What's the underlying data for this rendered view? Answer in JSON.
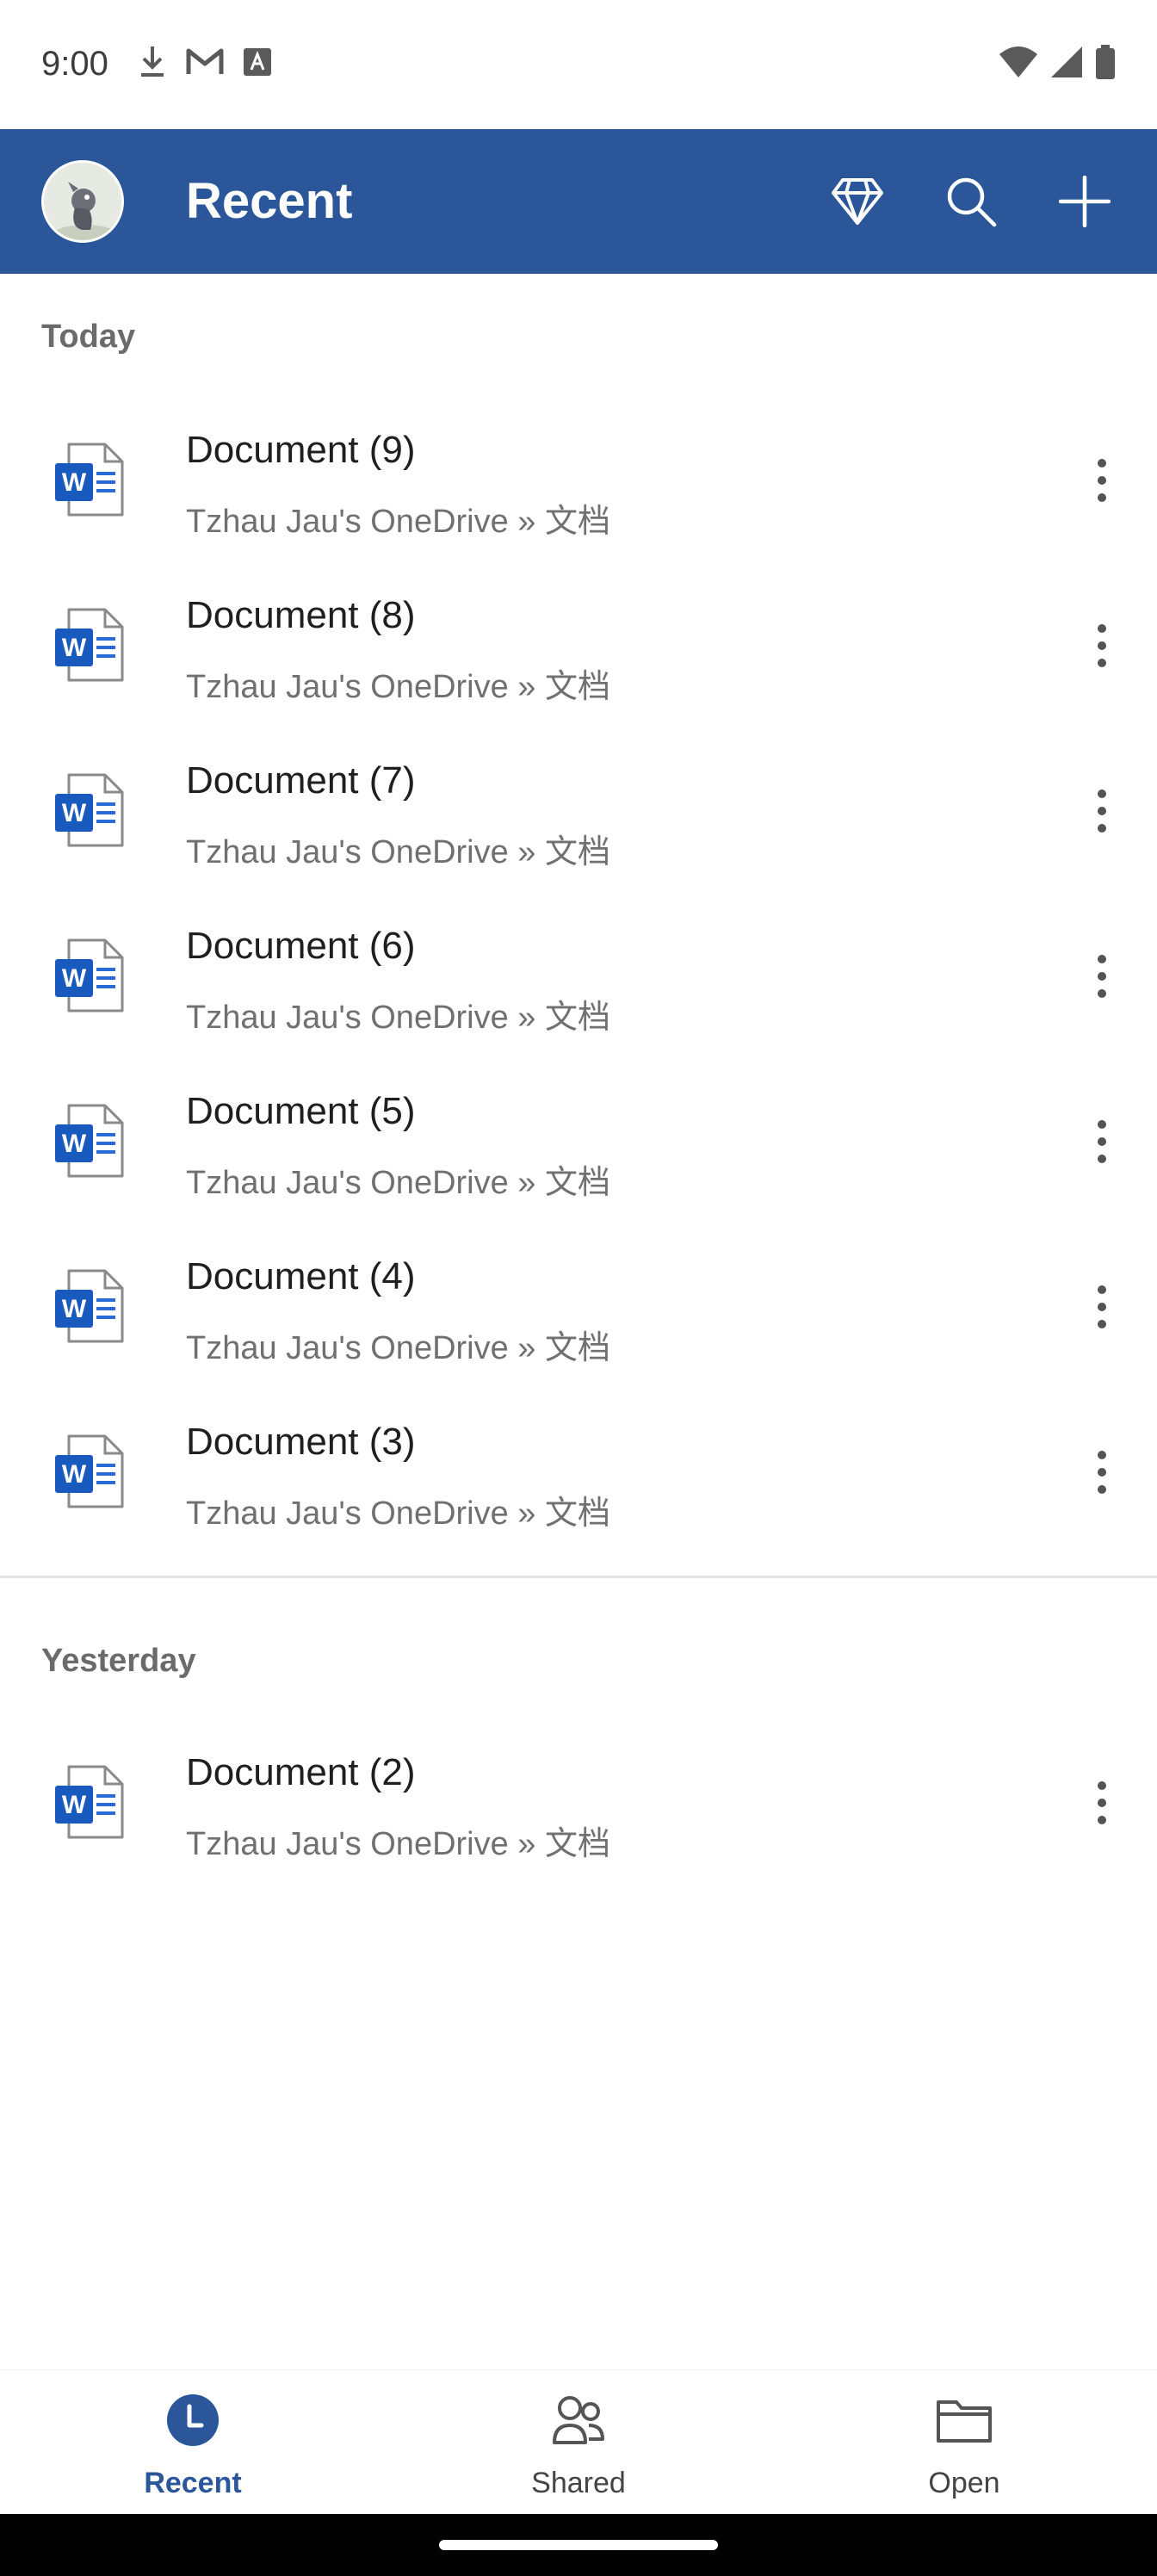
{
  "status_bar": {
    "time": "9:00",
    "left_icons": [
      "download-icon",
      "gmail-icon",
      "font-a-icon"
    ],
    "right_icons": [
      "wifi-icon",
      "signal-icon",
      "battery-icon"
    ]
  },
  "app_bar": {
    "title": "Recent",
    "background": "#2b579a",
    "actions": [
      "premium-diamond-icon",
      "search-icon",
      "add-icon"
    ]
  },
  "sections": [
    {
      "header": "Today",
      "documents": [
        {
          "title": "Document (9)",
          "location": "Tzhau Jau's OneDrive » 文档"
        },
        {
          "title": "Document (8)",
          "location": "Tzhau Jau's OneDrive » 文档"
        },
        {
          "title": "Document (7)",
          "location": "Tzhau Jau's OneDrive » 文档"
        },
        {
          "title": "Document (6)",
          "location": "Tzhau Jau's OneDrive » 文档"
        },
        {
          "title": "Document (5)",
          "location": "Tzhau Jau's OneDrive » 文档"
        },
        {
          "title": "Document (4)",
          "location": "Tzhau Jau's OneDrive » 文档"
        },
        {
          "title": "Document (3)",
          "location": "Tzhau Jau's OneDrive » 文档"
        }
      ]
    },
    {
      "header": "Yesterday",
      "documents": [
        {
          "title": "Document (2)",
          "location": "Tzhau Jau's OneDrive » 文档"
        }
      ]
    }
  ],
  "bottom_nav": [
    {
      "label": "Recent",
      "icon": "clock-icon",
      "active": true
    },
    {
      "label": "Shared",
      "icon": "people-icon",
      "active": false
    },
    {
      "label": "Open",
      "icon": "folder-icon",
      "active": false
    }
  ],
  "colors": {
    "accent": "#2b579a",
    "word_blue": "#185abd",
    "subtext": "#707070"
  }
}
